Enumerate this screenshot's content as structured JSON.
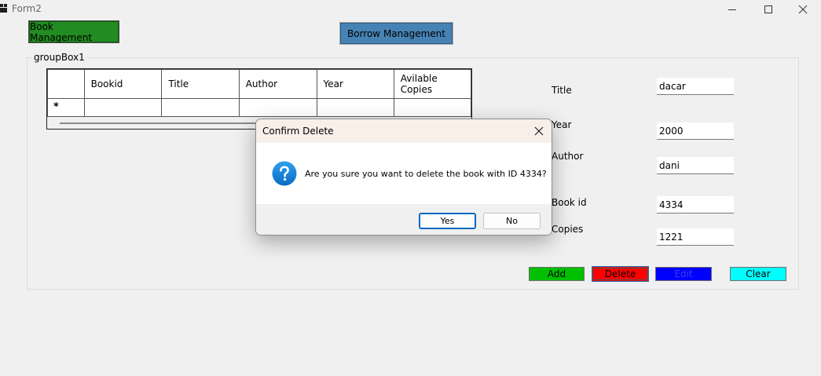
{
  "window": {
    "title": "Form2"
  },
  "nav": {
    "book_management": "Book Management",
    "borrow_management": "Borrow Management"
  },
  "groupbox": {
    "label": "groupBox1"
  },
  "grid": {
    "columns": [
      "Bookid",
      "Title",
      "Author",
      "Year",
      "Avilable Copies"
    ],
    "new_row_marker": "*"
  },
  "form": {
    "title_label": "Title",
    "title_value": "dacar",
    "year_label": "Year",
    "year_value": "2000",
    "author_label": "Author",
    "author_value": "dani",
    "bookid_label": "Book id",
    "bookid_value": "4334",
    "copies_label": "Copies",
    "copies_value": "1221"
  },
  "actions": {
    "add": "Add",
    "delete": "Delete",
    "edit": "Edit",
    "clear": "Clear"
  },
  "dialog": {
    "title": "Confirm Delete",
    "message": "Are you sure you want to delete the book with ID 4334?",
    "yes": "Yes",
    "no": "No",
    "icon": "question-icon"
  },
  "colors": {
    "book_management": "#228b22",
    "borrow_management": "#4682b4",
    "add": "#00c000",
    "delete": "#ff0000",
    "edit": "#0000ff",
    "clear": "#00ffff"
  }
}
